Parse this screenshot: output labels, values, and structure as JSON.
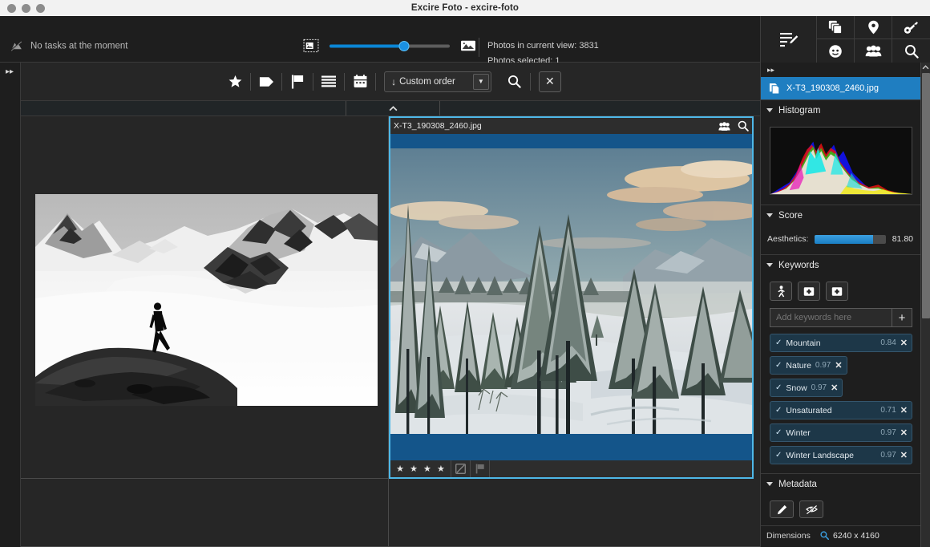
{
  "window": {
    "title": "Excire Foto - excire-foto",
    "traffic_lights": [
      "close",
      "minimize",
      "zoom"
    ]
  },
  "appbar": {
    "task_status": "No tasks at the moment",
    "task_icon": "no-task-icon",
    "thumb_small_icon": "small-thumbnail-icon",
    "thumb_large_icon": "large-thumbnail-icon",
    "zoom_slider_percent": 62,
    "photos_in_view_label": "Photos in current view: 3831",
    "photos_selected_label": "Photos selected: 1"
  },
  "top_right_icons": {
    "main": "edit-list-icon",
    "grid": [
      "duplicates-icon",
      "location-pin-icon",
      "key-icon",
      "face-icon",
      "people-icon",
      "search-icon"
    ]
  },
  "left_rail": {
    "expand_icon": "▸▸"
  },
  "filter_toolbar": {
    "buttons": [
      {
        "name": "star-rating-filter",
        "icon": "star-icon",
        "glyph": "★"
      },
      {
        "name": "color-label-filter",
        "icon": "tag-icon",
        "glyph": "tag"
      },
      {
        "name": "flag-filter",
        "icon": "flag-icon",
        "glyph": "flag"
      },
      {
        "name": "list-filter",
        "icon": "lines-icon",
        "glyph": "lines"
      },
      {
        "name": "date-filter",
        "icon": "calendar-icon",
        "glyph": "calendar"
      }
    ],
    "sort": {
      "direction_icon": "arrow-down-icon",
      "direction_glyph": "↓",
      "label": "Custom order",
      "caret_glyph": "▼"
    },
    "search_icon": "search-icon",
    "close_label": "✕"
  },
  "collapse_strip": {
    "chevron": "⌃"
  },
  "grid": {
    "cells": [
      {
        "name": "photo-cell-mountain",
        "selected": false,
        "alt": "black and white photo of a hiker on a rocky ridge above a glacier"
      },
      {
        "name": "photo-cell-winter-forest",
        "selected": true,
        "filename": "X-T3_190308_2460.jpg",
        "header_icons": [
          "people-icon",
          "zoom-icon"
        ],
        "rating": 4,
        "rating_glyph": "★",
        "color_label_icon": "no-color-label-icon",
        "flag_icon": "flag-icon",
        "alt": "snow covered pine forest with mountains at dusk"
      }
    ]
  },
  "right_panel": {
    "collapse_icon": "▸▸",
    "file": {
      "icon": "copy-photo-icon",
      "name": "X-T3_190308_2460.jpg"
    },
    "sections": {
      "histogram": {
        "title": "Histogram",
        "expanded": true
      },
      "score": {
        "title": "Score",
        "expanded": true,
        "metric_label": "Aesthetics:",
        "metric_value": "81.80",
        "metric_percent": 81.8
      },
      "keywords": {
        "title": "Keywords",
        "expanded": true,
        "tool_buttons": [
          "person-keyword-icon",
          "add-keyword-box-icon",
          "remove-keyword-box-icon"
        ],
        "input_placeholder": "Add keywords here",
        "input_value": "",
        "add_button": "+",
        "items": [
          {
            "name": "Mountain",
            "score": "0.84",
            "checked": true,
            "wide": true
          },
          {
            "name": "Nature",
            "score": "0.97",
            "checked": true,
            "wide": false
          },
          {
            "name": "Snow",
            "score": "0.97",
            "checked": true,
            "wide": false
          },
          {
            "name": "Unsaturated",
            "score": "0.71",
            "checked": true,
            "wide": true
          },
          {
            "name": "Winter",
            "score": "0.97",
            "checked": true,
            "wide": true
          },
          {
            "name": "Winter Landscape",
            "score": "0.97",
            "checked": true,
            "wide": true
          }
        ],
        "check_glyph": "✓",
        "remove_glyph": "✕"
      },
      "metadata": {
        "title": "Metadata",
        "expanded": true,
        "tool_buttons": [
          "edit-pencil-icon",
          "hide-eye-icon"
        ],
        "rows": [
          {
            "key": "Dimensions",
            "value": "6240 x 4160",
            "icon": "search-icon"
          }
        ]
      }
    }
  },
  "colors": {
    "accent_blue": "#1f7ec1",
    "selection_border": "#4eb8e8",
    "panel_bg": "#1e1e1e",
    "grid_bg": "#262626",
    "chip_bg": "#1d3748"
  }
}
